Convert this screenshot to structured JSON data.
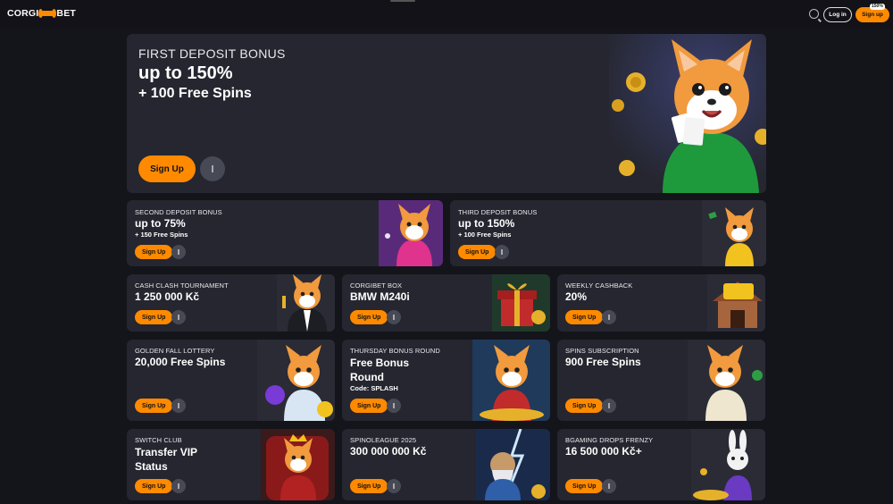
{
  "header": {
    "logo_left": "CORGI",
    "logo_right": "BET",
    "login_label": "Log in",
    "signup_label": "Sign up",
    "signup_badge": "150%"
  },
  "hero": {
    "title": "FIRST DEPOSIT BONUS",
    "value": "up to 150%",
    "sub": "+ 100 Free Spins",
    "button": "Sign Up"
  },
  "row2": [
    {
      "title": "SECOND DEPOSIT BONUS",
      "value": "up to 75%",
      "sub": "+ 150 Free Spins",
      "button": "Sign Up"
    },
    {
      "title": "THIRD DEPOSIT BONUS",
      "value": "up to 150%",
      "sub": "+ 100 Free Spins",
      "button": "Sign Up"
    }
  ],
  "row3": [
    {
      "title": "CASH CLASH TOURNAMENT",
      "value": "1 250 000 Kč",
      "button": "Sign Up"
    },
    {
      "title": "CORGIBET BOX",
      "value": "BMW M240i",
      "button": "Sign Up"
    },
    {
      "title": "WEEKLY CASHBACK",
      "value": "20%",
      "button": "Sign Up"
    }
  ],
  "row4": [
    {
      "title": "GOLDEN FALL LOTTERY",
      "value": "20,000 Free Spins",
      "button": "Sign Up"
    },
    {
      "title": "THURSDAY BONUS ROUND",
      "value": "Free Bonus Round",
      "sub": "Code: SPLASH",
      "button": "Sign Up"
    },
    {
      "title": "SPINS SUBSCRIPTION",
      "value": "900 Free Spins",
      "button": "Sign Up"
    }
  ],
  "row5": [
    {
      "title": "SWITCH CLUB",
      "value": "Transfer VIP Status",
      "button": "Sign Up"
    },
    {
      "title": "SPINOLEAGUE 2025",
      "value": "300 000 000 Kč",
      "button": "Sign Up"
    },
    {
      "title": "BGAMING DROPS FRENZY",
      "value": "16 500 000 Kč+",
      "button": "Sign Up"
    }
  ],
  "colors": {
    "accent": "#ff8a00",
    "card": "#25262f",
    "bg": "#14141b"
  }
}
